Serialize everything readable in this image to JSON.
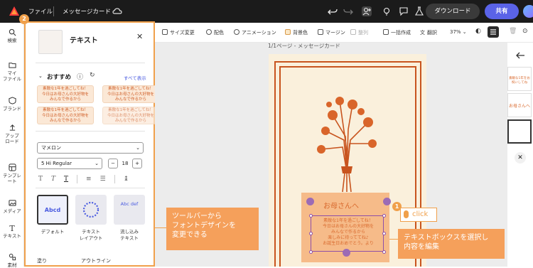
{
  "topbar": {
    "file_menu": "ファイル",
    "doc_title": "メッセージカード",
    "download_label": "ダウンロード",
    "share_label": "共有"
  },
  "leftnav": {
    "items": [
      {
        "label": "検索",
        "icon": "search-icon"
      },
      {
        "label": "マイ\nファイル",
        "icon": "folder-icon"
      },
      {
        "label": "ブランド",
        "icon": "brand-icon"
      },
      {
        "label": "アップ\nロード",
        "icon": "upload-icon"
      },
      {
        "label": "テンプレ\nート",
        "icon": "template-icon"
      },
      {
        "label": "メディア",
        "icon": "media-icon"
      },
      {
        "label": "テキスト",
        "icon": "text-icon"
      },
      {
        "label": "素材",
        "icon": "elements-icon"
      }
    ]
  },
  "panel": {
    "step_number": "2",
    "title": "テキスト",
    "recommended_label": "おすすめ",
    "show_all": "すべて表示",
    "presets": [
      "素敵な1年を過ごしてね！\n今日はお母さんの大好物を\nみんなで作るから",
      "素敵な1年を過ごしてね！\n今日はお母さんの大好物を\nみんなで作るから",
      "素敵な1年を過ごしてね！\n今日はお母さんの大好物を\nみんなで作るから",
      "素敵な1年を過ごしてね！\n今日はお母さんの大好物を\nみんなで作るから"
    ],
    "font_family": "マメロン",
    "font_weight": "5 Hi Regular",
    "font_size": "18",
    "styles": [
      {
        "preview": "Abcd",
        "label": "デフォルト"
      },
      {
        "preview": "ABCDEFG",
        "label": "テキスト\nレイアウト"
      },
      {
        "preview": "Abc def",
        "label": "流し込み\nテキスト"
      }
    ],
    "fill_label": "塗り",
    "outline_label": "アウトライン"
  },
  "toolbar": {
    "resize": "サイズ変更",
    "color": "配色",
    "animation": "アニメーション",
    "background_color": "背景色",
    "margin": "マージン",
    "arrange": "整列",
    "bulk_create": "一括作成",
    "translate": "翻訳",
    "zoom": "37%"
  },
  "canvas": {
    "page_label": "1/1ページ - メッセージカード",
    "card_heading": "お母さんへ",
    "card_body": "素敵な1年を過ごしてね！\n今日はお母さんの大好物を\nみんなで作るから\n楽しみに待っててね♪\nお誕生日おめでとう。より"
  },
  "annotations": {
    "callout_left": "ツールバーから\nフォントデザインを\n変更できる",
    "callout_right": "テキストボックスを選択し\n内容を編集",
    "step1_number": "1",
    "click_text": "click"
  },
  "right_panel": {
    "thumb1": "素敵な1年をお祝いしてね",
    "thumb2": "お母さんへ"
  },
  "colors": {
    "accent_orange": "#f0a04b",
    "card_orange": "#c8541e",
    "share_button": "#5a63e8",
    "card_bg": "#faf0dc"
  }
}
